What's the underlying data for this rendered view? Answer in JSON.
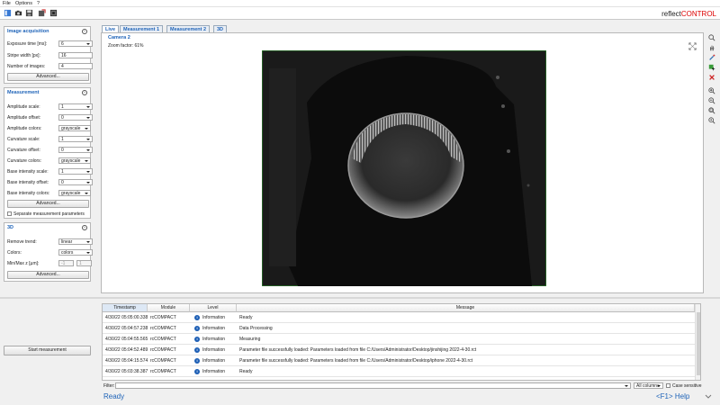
{
  "menu": {
    "file": "File",
    "options": "Options",
    "help": "?"
  },
  "toolbar": {
    "icons": [
      "panel-icon",
      "camera-icon",
      "save-icon",
      "export-icon",
      "settings-icon"
    ]
  },
  "logo": {
    "part1": "reflect",
    "part2": "CONTROL"
  },
  "acquisition": {
    "title": "Image acquisition",
    "rows": [
      {
        "label": "Exposure time [ms]:",
        "value": "6"
      },
      {
        "label": "Stripe width [px]:",
        "value": "16"
      },
      {
        "label": "Number of images:",
        "value": "4"
      }
    ],
    "advanced": "Advanced..."
  },
  "measurement": {
    "title": "Measurement",
    "rows": [
      {
        "label": "Amplitude scale:",
        "value": "1"
      },
      {
        "label": "Amplitude offset:",
        "value": "0"
      },
      {
        "label": "Amplitude colors:",
        "value": "grayscale"
      },
      {
        "label": "Curvature scale:",
        "value": "1"
      },
      {
        "label": "Curvature offset:",
        "value": "0"
      },
      {
        "label": "Curvature colors:",
        "value": "grayscale"
      },
      {
        "label": "Base intensity scale:",
        "value": "1"
      },
      {
        "label": "Base intensity offset:",
        "value": "0"
      },
      {
        "label": "Base intensity colors:",
        "value": "grayscale"
      }
    ],
    "advanced": "Advanced...",
    "separate": "Separate measurement parameters"
  },
  "three_d": {
    "title": "3D",
    "rows": [
      {
        "label": "Remove trend:",
        "value": "linear"
      },
      {
        "label": "Colors:",
        "value": "colors"
      }
    ],
    "minmax_label": "Min/Max z [µm]:",
    "min": "-1",
    "max": "1",
    "advanced": "Advanced..."
  },
  "start_button": "Start measurement",
  "tabs": [
    "Live",
    "Measurement 1",
    "Measurement 2",
    "3D"
  ],
  "view": {
    "camera": "Camera 2",
    "zoom": "Zoom factor: 61%"
  },
  "log": {
    "columns": [
      "Timestamp",
      "Module",
      "Level",
      "Message"
    ],
    "rows": [
      {
        "ts": "4/30/22 05:05:00.338",
        "module": "rcCOMPACT",
        "level": "Information",
        "message": "Ready"
      },
      {
        "ts": "4/30/22 05:04:57.238",
        "module": "rcCOMPACT",
        "level": "Information",
        "message": "Data Processing"
      },
      {
        "ts": "4/30/22 05:04:55.565",
        "module": "rcCOMPACT",
        "level": "Information",
        "message": "Measuring"
      },
      {
        "ts": "4/30/22 05:04:52.489",
        "module": "rcCOMPACT",
        "level": "Information",
        "message": "Parameter file successfully loaded: Parameters loaded from file C:/Users/Administrator/Desktop/jinshijing 2022-4-30.rct"
      },
      {
        "ts": "4/30/22 05:04:15.574",
        "module": "rcCOMPACT",
        "level": "Information",
        "message": "Parameter file successfully loaded: Parameters loaded from file C:/Users/Administrator/Desktop/iphone 2022-4-30.rct"
      },
      {
        "ts": "4/30/22 05:03:38.387",
        "module": "rcCOMPACT",
        "level": "Information",
        "message": "Ready"
      }
    ],
    "filter_label": "Filter:",
    "filter_columns": "All columns",
    "case_sensitive": "Case sensitive"
  },
  "status": {
    "ready": "Ready",
    "help": "<F1> Help"
  },
  "colors": {
    "accent": "#1e63b8",
    "logo_red": "#dd0000",
    "frame_green": "#2e9b2e"
  }
}
